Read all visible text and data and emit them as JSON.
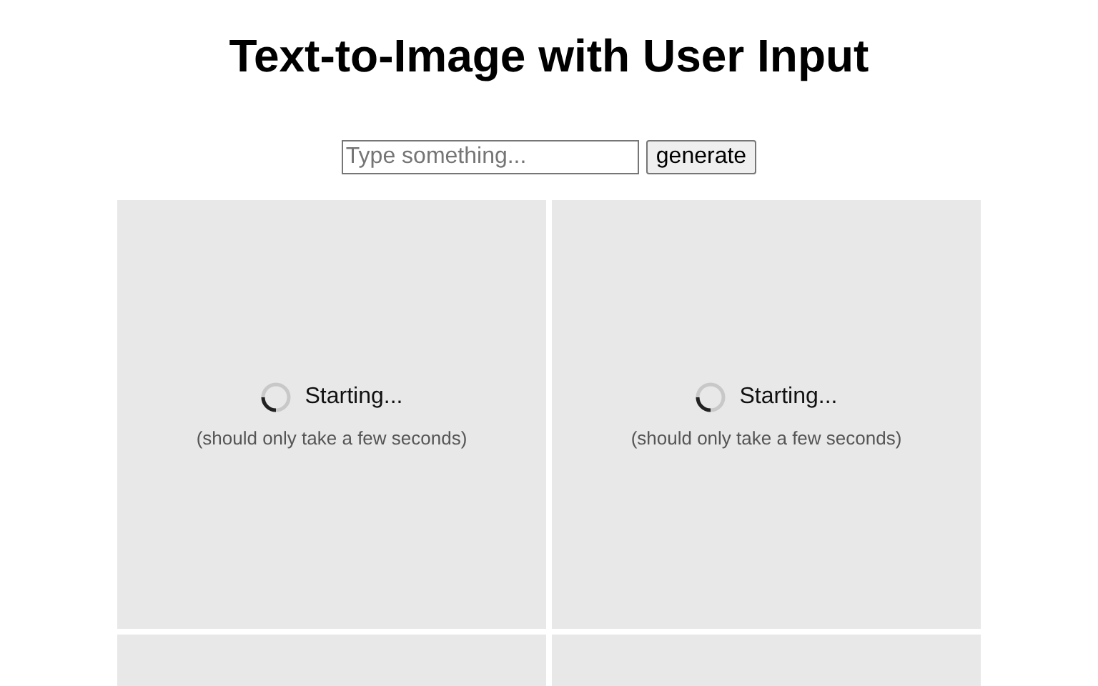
{
  "title": "Text-to-Image with User Input",
  "prompt": {
    "placeholder": "Type something..."
  },
  "button": "generate",
  "tiles": [
    {
      "kind": "loading",
      "status": "Starting...",
      "note": "(should only take a few seconds)"
    },
    {
      "kind": "loading",
      "status": "Starting...",
      "note": "(should only take a few seconds)"
    },
    {
      "kind": "blank"
    },
    {
      "kind": "blank"
    }
  ]
}
